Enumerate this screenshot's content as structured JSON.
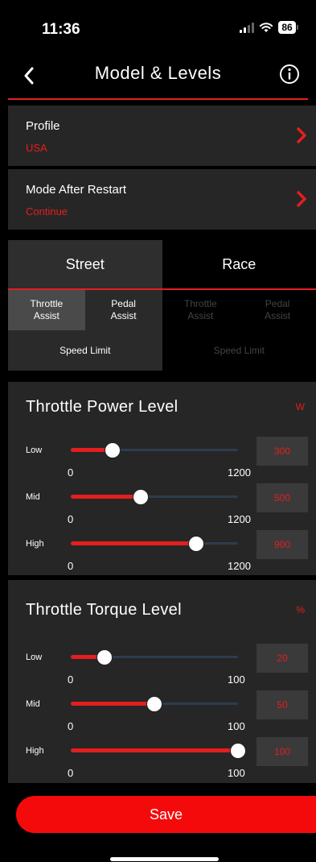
{
  "status": {
    "time": "11:36",
    "battery": "86"
  },
  "nav": {
    "title": "Model & Levels",
    "back_icon": "chevron-left-icon",
    "info_icon": "info-icon"
  },
  "profile": {
    "label": "Profile",
    "value": "USA"
  },
  "mode_after_restart": {
    "label": "Mode After Restart",
    "value": "Continue"
  },
  "mode_tabs": [
    {
      "label": "Street",
      "active": true
    },
    {
      "label": "Race",
      "active": false
    }
  ],
  "street_sub_tabs": [
    {
      "line1": "Throttle",
      "line2": "Assist",
      "state": "active"
    },
    {
      "line1": "Pedal",
      "line2": "Assist",
      "state": "normal"
    }
  ],
  "race_sub_tabs": [
    {
      "line1": "Throttle",
      "line2": "Assist",
      "state": "dim"
    },
    {
      "line1": "Pedal",
      "line2": "Assist",
      "state": "dim"
    }
  ],
  "speed_tabs": [
    {
      "label": "Speed Limit",
      "state": "normal"
    },
    {
      "label": "Speed Limit",
      "state": "dim"
    }
  ],
  "power_panel": {
    "title": "Throttle Power Level",
    "unit": "W",
    "sliders": [
      {
        "label": "Low",
        "min": "0",
        "max": "1200",
        "value": "300",
        "fraction": 0.25
      },
      {
        "label": "Mid",
        "min": "0",
        "max": "1200",
        "value": "500",
        "fraction": 0.417
      },
      {
        "label": "High",
        "min": "0",
        "max": "1200",
        "value": "900",
        "fraction": 0.75
      }
    ]
  },
  "torque_panel": {
    "title": "Throttle Torque Level",
    "unit": "%",
    "sliders": [
      {
        "label": "Low",
        "min": "0",
        "max": "100",
        "value": "20",
        "fraction": 0.2
      },
      {
        "label": "Mid",
        "min": "0",
        "max": "100",
        "value": "50",
        "fraction": 0.5
      },
      {
        "label": "High",
        "min": "0",
        "max": "100",
        "value": "100",
        "fraction": 1.0
      }
    ]
  },
  "save": {
    "label": "Save"
  },
  "colors": {
    "accent": "#e41e1e",
    "card": "#262626",
    "track": "#2c3d4e"
  }
}
